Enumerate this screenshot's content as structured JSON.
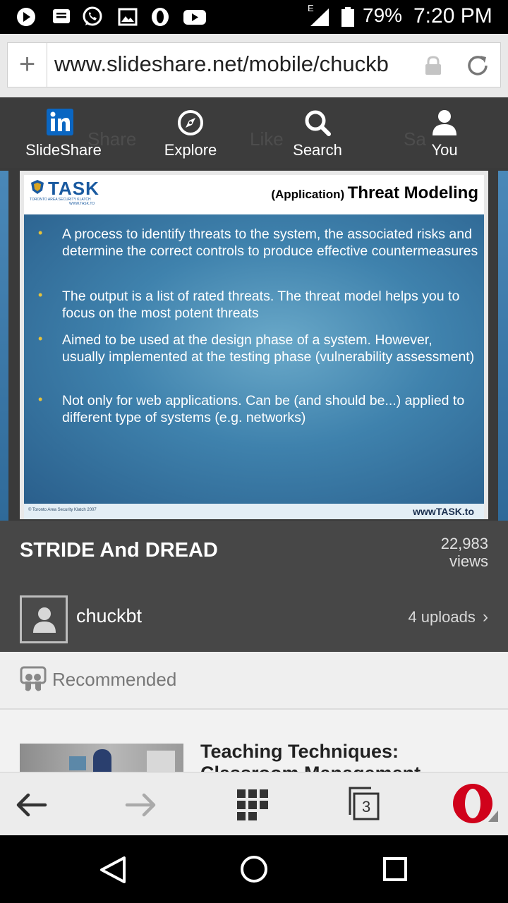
{
  "status_bar": {
    "battery_percent": "79%",
    "time": "7:20 PM",
    "network_type": "E",
    "icons": [
      "play-store-icon",
      "messages-icon",
      "whatsapp-icon",
      "gallery-icon",
      "opera-icon",
      "youtube-icon",
      "signal-icon",
      "battery-icon"
    ]
  },
  "browser": {
    "url": "www.slideshare.net/mobile/chuckb",
    "tab_count": "3"
  },
  "app_nav": {
    "background_items": [
      "Share",
      "Like",
      "Sa"
    ],
    "items": [
      {
        "label": "SlideShare",
        "icon": "linkedin-icon"
      },
      {
        "label": "Explore",
        "icon": "compass-icon"
      },
      {
        "label": "Search",
        "icon": "search-icon"
      },
      {
        "label": "You",
        "icon": "user-icon"
      }
    ]
  },
  "slide": {
    "logo_text": "TASK",
    "logo_subtitle": "TORONTO AREA SECURITY KLATCH",
    "logo_url": "WWW.TASK.TO",
    "title_prefix": "(Application)",
    "title": "Threat Modeling",
    "bullets": [
      "A process to identify threats to the system, the associated risks and determine the correct controls to produce effective countermeasures",
      "The output is a list of rated threats. The threat model helps you to focus on the most potent threats",
      "Aimed to be used at the design phase of a system. However, usually implemented at the testing phase (vulnerability assessment)",
      "Not only for web applications. Can be (and should be...) applied to different type of systems (e.g. networks)"
    ],
    "footer_left": "© Toronto Area Security Klatch 2007",
    "footer_right": "wwwTASK.to"
  },
  "deck": {
    "title": "STRIDE And DREAD",
    "views_count": "22,983",
    "views_label": "views",
    "author": "chuckbt",
    "uploads": "4 uploads"
  },
  "recommended": {
    "label": "Recommended",
    "first_item_title": "Teaching Techniques: Classroom Management"
  },
  "colors": {
    "status_bar": "#000000",
    "nav_bar": "#3c3c3c",
    "info_panel": "#474747",
    "linkedin_blue": "#0a66c2",
    "opera_red": "#d0021b",
    "slide_blue": "#3f82ad",
    "bullet_gold": "#e6c23a"
  }
}
